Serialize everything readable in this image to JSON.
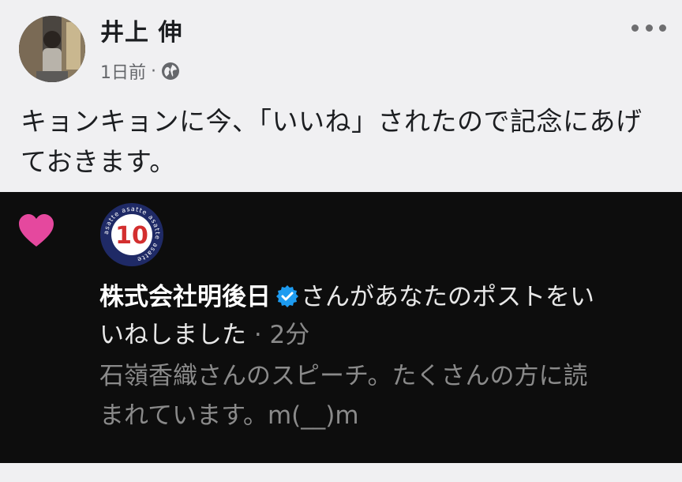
{
  "post": {
    "author": "井上 伸",
    "time": "1日前",
    "separator": "·",
    "privacy_icon": "globe-icon",
    "more_icon": "more-horizontal-icon",
    "text_line1": "キョンキョンに今、「いいね」されたので記念にあげ",
    "text_line2": "ておきます。"
  },
  "notification": {
    "reaction_icon": "heart-icon",
    "logo_text": "10",
    "logo_ring_text": "asatte",
    "org_name": "株式会社明後日",
    "verified_icon": "verified-badge-icon",
    "action_line1": "さんがあなたのポストをい",
    "action_line2": "いねしました",
    "time": " · 2分",
    "preview_line1": "石嶺香織さんのスピーチ。たくさんの方に読",
    "preview_line2": "まれています。m(__)m"
  },
  "colors": {
    "heart": "#e5489e",
    "logo_red": "#d32f2f",
    "logo_navy": "#1f2a66",
    "verified": "#1d9bf0"
  }
}
